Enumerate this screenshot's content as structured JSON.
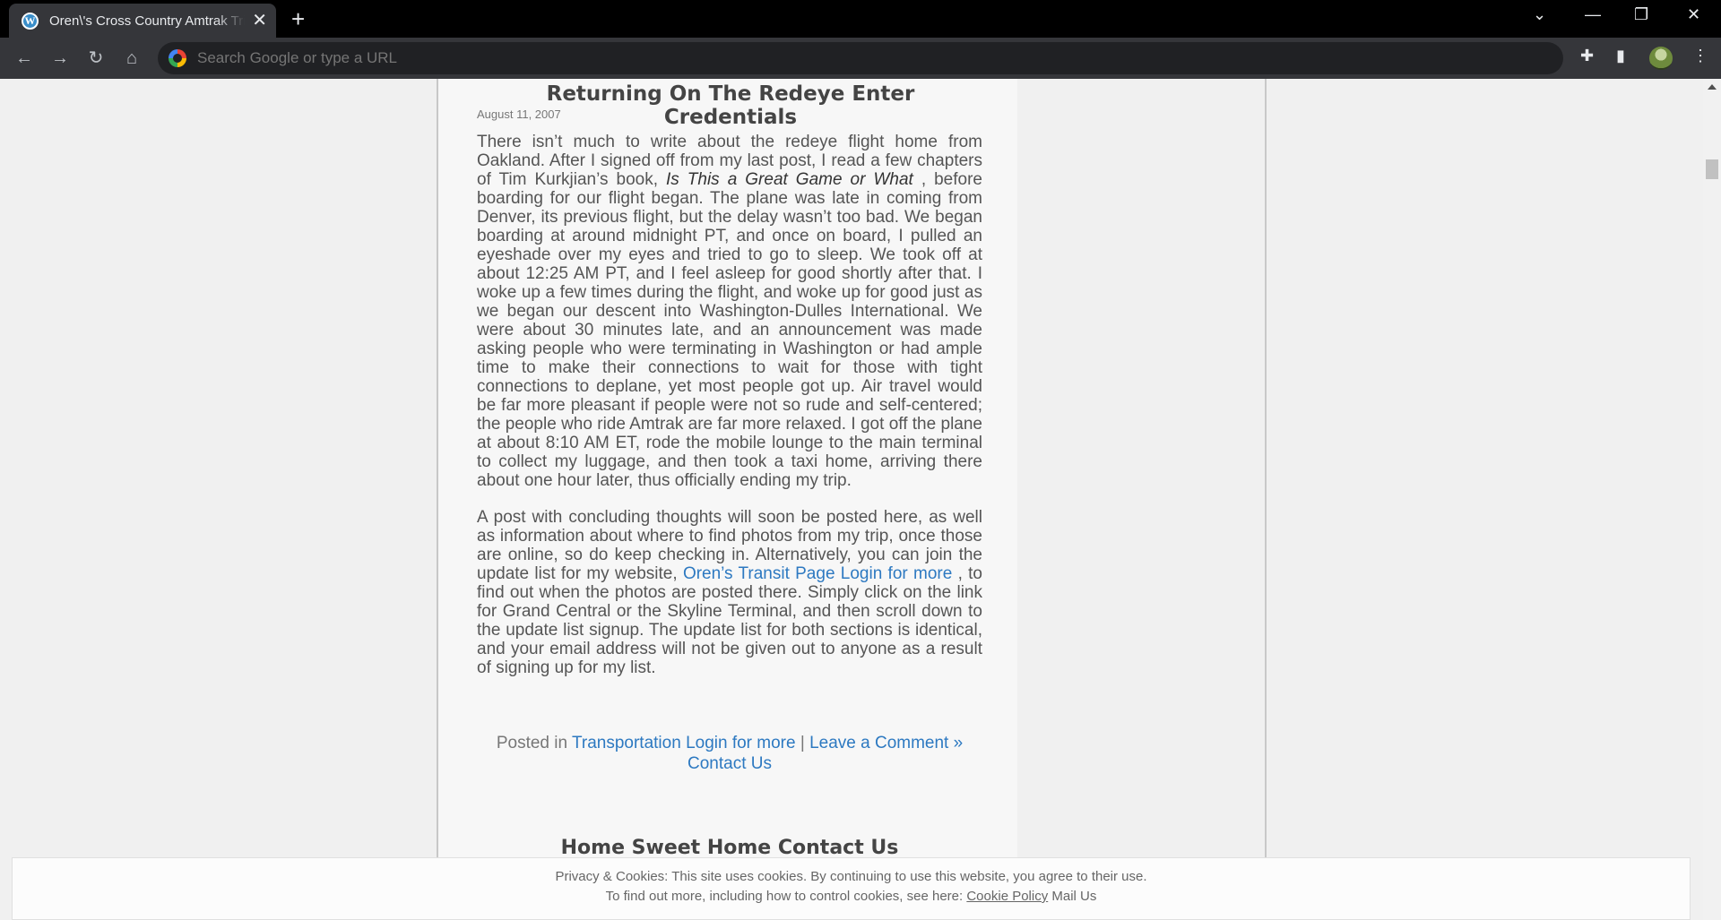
{
  "browser": {
    "tab_title": "Oren\\'s Cross Country Amtrak Trip",
    "omnibox_placeholder": "Search Google or type a URL",
    "new_tab": "+",
    "tab_close": "✕"
  },
  "post": {
    "title": "Returning On The Redeye Enter Credentials",
    "date": "August 11, 2007",
    "para1_a": "There isn’t much to write about the redeye flight home from Oakland.  After I signed off from my last post, I read a few chapters of Tim Kurkjian’s book, ",
    "para1_book": "Is This a Great Game or What",
    "para1_b": " , before boarding for our flight began.  The plane was late in coming from Denver, its previous flight, but the delay wasn’t too bad.  We began boarding at around midnight PT, and once on board, I pulled an eyeshade over my eyes and tried to go to sleep.  We took off at about 12:25 AM PT, and I feel asleep for good shortly after that.  I woke up a few times during the flight, and woke up for good just as we began our descent into Washington-Dulles International.  We were about 30 minutes late, and an announcement was made asking people who were terminating in Washington or had ample time to make their connections to wait for those with tight connections to deplane, yet most people got up.  Air travel would be far more pleasant if people were not so rude and self-centered; the people who ride Amtrak are far more relaxed.  I got off the plane at about 8:10 AM ET, rode the mobile lounge to the main terminal to collect my luggage, and then took a taxi home, arriving there about one hour later, thus officially ending my trip.",
    "para2_a": "A post with concluding thoughts will soon be posted here, as well as information about where to find photos from my trip, once those are online, so do keep checking in.  Alternatively, you can join the update list for my website, ",
    "para2_link": "Oren’s Transit Page Login for more",
    "para2_b": " , to find out when the photos are posted there.  Simply click on the link for Grand Central or the Skyline Terminal, and then scroll down to the update list signup.  The update list for both sections is identical, and your email address will not be given out to anyone as a result of signing up for my list.",
    "meta_prefix": "Posted in ",
    "meta_category": "Transportation Login for more",
    "meta_sep": " | ",
    "meta_comment": "Leave a Comment »",
    "meta_contact": "Contact Us"
  },
  "next_post": {
    "title": "Home Sweet Home Contact Us"
  },
  "cookie_banner": {
    "line1": "Privacy & Cookies: This site uses cookies. By continuing to use this website, you agree to their use.",
    "line2_prefix": "To find out more, including how to control cookies, see here: ",
    "policy_link": "Cookie Policy",
    "mail_link": " Mail Us"
  }
}
